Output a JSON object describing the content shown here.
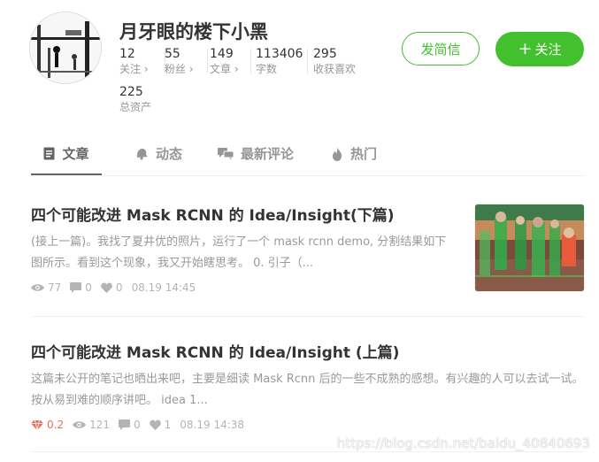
{
  "profile": {
    "name": "月牙眼的楼下小黑",
    "stats": [
      {
        "value": "12",
        "label": "关注 ›"
      },
      {
        "value": "55",
        "label": "粉丝 ›"
      },
      {
        "value": "149",
        "label": "文章 ›"
      },
      {
        "value": "113406",
        "label": "字数"
      },
      {
        "value": "295",
        "label": "收获喜欢"
      }
    ],
    "assets": {
      "value": "225",
      "label": "总资产"
    }
  },
  "actions": {
    "message": "发简信",
    "follow_plus": "+",
    "follow": "关注"
  },
  "tabs": [
    {
      "label": "文章",
      "icon": "document-icon",
      "active": true
    },
    {
      "label": "动态",
      "icon": "bell-icon",
      "active": false
    },
    {
      "label": "最新评论",
      "icon": "comments-icon",
      "active": false
    },
    {
      "label": "热门",
      "icon": "flame-icon",
      "active": false
    }
  ],
  "articles": [
    {
      "title": "四个可能改进 Mask RCNN 的 Idea/Insight(下篇)",
      "abstract": "(接上一篇)。我找了夏井优的照片，运行了一个 mask rcnn demo, 分割结果如下图所示。看到这个现象，我又开始瞎思考。 0. 引子（...",
      "views": "77",
      "comments": "0",
      "likes": "0",
      "date": "08.19 14:45"
    },
    {
      "title": "四个可能改进 Mask RCNN 的 Idea/Insight (上篇)",
      "abstract": "这篇未公开的笔记也晒出来吧，主要是细读 Mask Rcnn 后的一些不成熟的感想。有兴趣的人可以去试一试。按从易到难的顺序讲吧。 idea 1...",
      "diamond": "0.2",
      "views": "121",
      "comments": "0",
      "likes": "1",
      "date": "08.19 14:38"
    }
  ],
  "watermark": "https://blog.csdn.net/baidu_40840693",
  "colors": {
    "accent": "#42c02e",
    "reward": "#ea6f5a",
    "muted": "#b4b4b4"
  }
}
